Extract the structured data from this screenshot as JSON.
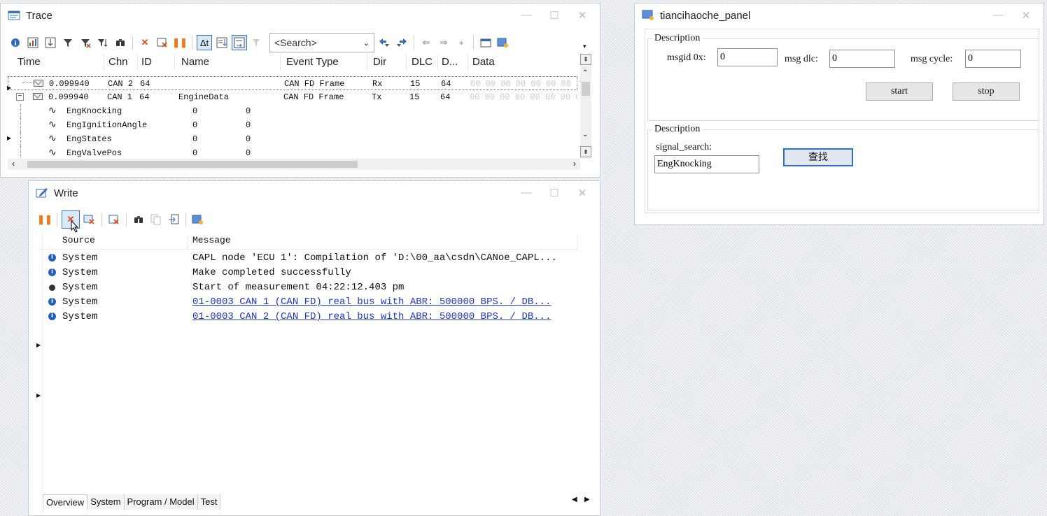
{
  "trace": {
    "title": "Trace",
    "search_placeholder": "<Search>",
    "columns": [
      "Time",
      "Chn",
      "ID",
      "Name",
      "Event Type",
      "Dir",
      "DLC",
      "D...",
      "Data"
    ],
    "rows": [
      {
        "time": "0.099940",
        "chn": "CAN 2",
        "id": "64",
        "name": "",
        "event": "CAN FD Frame",
        "dir": "Rx",
        "dlc": "15",
        "d": "64",
        "data": "00 00 00 00 00 00 00 00"
      },
      {
        "time": "0.099940",
        "chn": "CAN 1",
        "id": "64",
        "name": "EngineData",
        "event": "CAN FD Frame",
        "dir": "Tx",
        "dlc": "15",
        "d": "64",
        "data": "00 00 00 00 00 00 00 00"
      }
    ],
    "signals": [
      {
        "name": "EngKnocking",
        "v1": "0",
        "v2": "0"
      },
      {
        "name": "EngIgnitionAngle",
        "v1": "0",
        "v2": "0"
      },
      {
        "name": "EngStates",
        "v1": "0",
        "v2": "0"
      },
      {
        "name": "EngValvePos",
        "v1": "0",
        "v2": "0"
      }
    ]
  },
  "write": {
    "title": "Write",
    "col_source": "Source",
    "col_message": "Message",
    "rows": [
      {
        "icon": "info",
        "source": "System",
        "message": "CAPL node 'ECU 1': Compilation of 'D:\\00_aa\\csdn\\CANoe_CAPL...",
        "link": false
      },
      {
        "icon": "info",
        "source": "System",
        "message": "Make completed successfully",
        "link": false
      },
      {
        "icon": "dot",
        "source": "System",
        "message": "Start of measurement 04:22:12.403 pm",
        "link": false
      },
      {
        "icon": "info",
        "source": "System",
        "message": "01-0003 CAN 1 (CAN FD)  real bus with ABR: 500000 BPS. / DB...",
        "link": true
      },
      {
        "icon": "info",
        "source": "System",
        "message": "01-0003 CAN 2 (CAN FD)  real bus with ABR: 500000 BPS. / DB...",
        "link": true
      }
    ],
    "tabs": [
      "Overview",
      "System",
      "Program / Model",
      "Test"
    ]
  },
  "panel": {
    "title": "tiancihaoche_panel",
    "group1_legend": "Description",
    "msgid_label": "msgid 0x:",
    "msgid_value": "0",
    "dlc_label": "msg dlc:",
    "dlc_value": "0",
    "cycle_label": "msg cycle:",
    "cycle_value": "0",
    "start_label": "start",
    "stop_label": "stop",
    "group2_legend": "Description",
    "signal_label": "signal_search:",
    "signal_value": "EngKnocking",
    "find_label": "查找"
  },
  "window_controls": {
    "minimize": "—",
    "maximize": "☐",
    "close": "✕"
  }
}
